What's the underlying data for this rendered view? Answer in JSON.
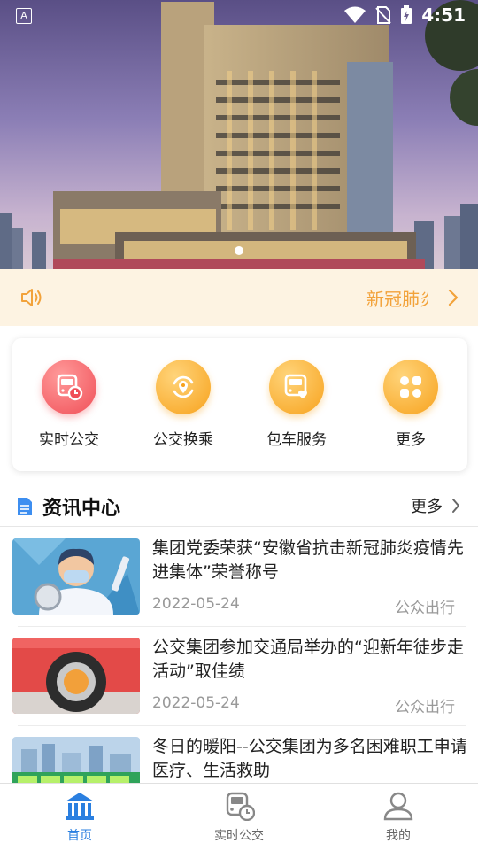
{
  "status_bar": {
    "time": "4:51"
  },
  "notice": {
    "text": "新冠肺炎疫情防控"
  },
  "quick_menu": [
    {
      "label": "实时公交",
      "icon": "bus-clock-icon",
      "color": "red"
    },
    {
      "label": "公交换乘",
      "icon": "transfer-icon",
      "color": "orange"
    },
    {
      "label": "包车服务",
      "icon": "bus-heart-icon",
      "color": "orange"
    },
    {
      "label": "更多",
      "icon": "grid-more-icon",
      "color": "orange"
    }
  ],
  "news_section": {
    "title": "资讯中心",
    "more_label": "更多"
  },
  "news": [
    {
      "title": "集团党委荣获“安徽省抗击新冠肺炎疫情先进集体”荣誉称号",
      "date": "2022-05-24",
      "source": "公众出行"
    },
    {
      "title": "公交集团参加交通局举办的“迎新年徒步走活动”取佳绩",
      "date": "2022-05-24",
      "source": "公众出行"
    },
    {
      "title": "冬日的暖阳--公交集团为多名困难职工申请医疗、生活救助",
      "date": "",
      "source": ""
    }
  ],
  "bottom_nav": [
    {
      "label": "首页",
      "active": true
    },
    {
      "label": "实时公交",
      "active": false
    },
    {
      "label": "我的",
      "active": false
    }
  ],
  "colors": {
    "accent_blue": "#2a7fe0",
    "notice_bg": "#fdf3e2",
    "notice_text": "#f2a23a",
    "red_icon": "#f04f57",
    "orange_icon": "#f7a21d"
  }
}
